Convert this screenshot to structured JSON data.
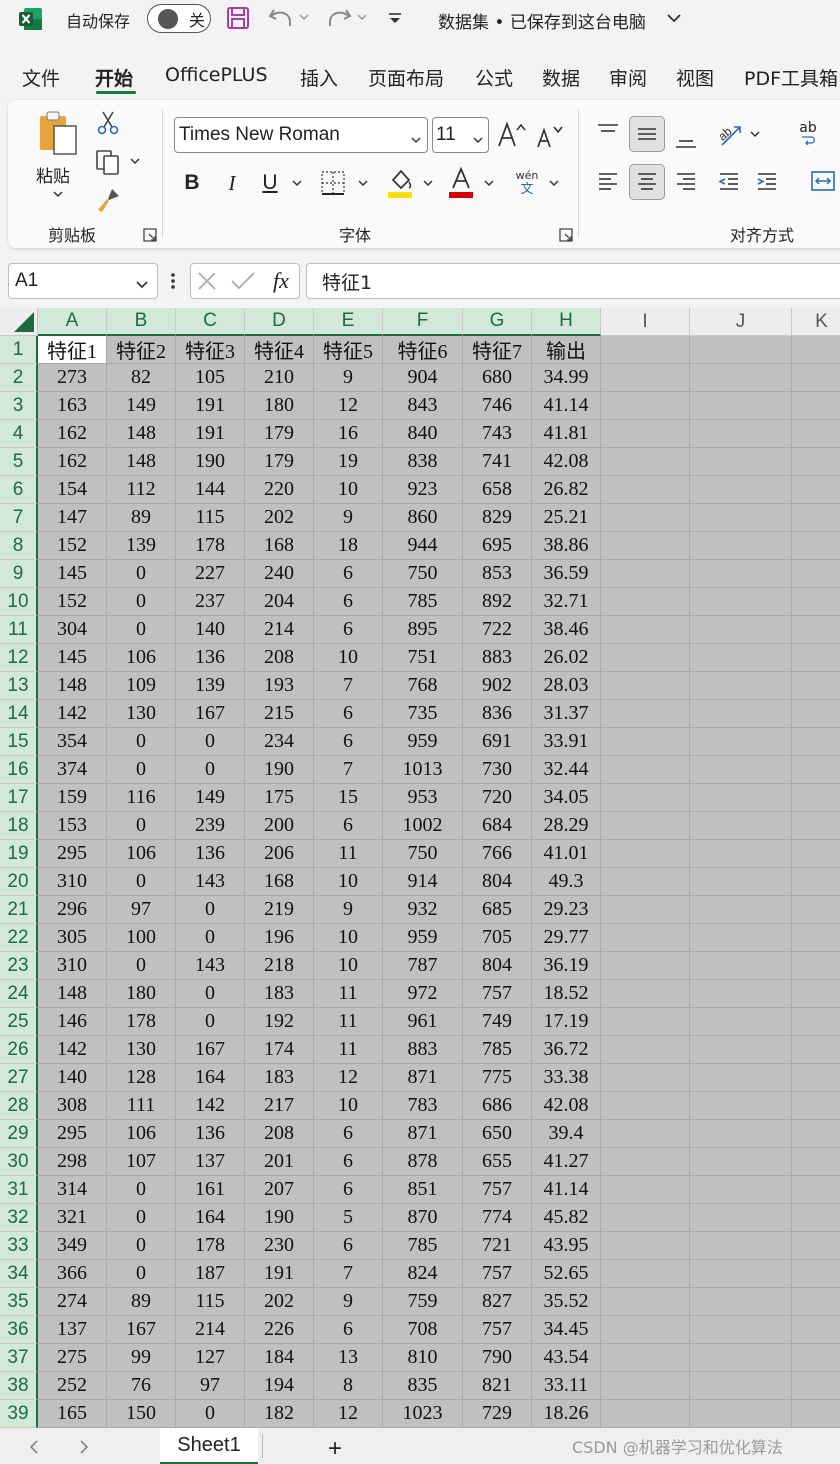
{
  "titlebar": {
    "autosave_label": "自动保存",
    "toggle_state": "关",
    "doc_title": "数据集 • 已保存到这台电脑"
  },
  "menu": {
    "tabs": [
      "文件",
      "开始",
      "OfficePLUS",
      "插入",
      "页面布局",
      "公式",
      "数据",
      "审阅",
      "视图",
      "PDF工具箱"
    ],
    "active": "开始"
  },
  "ribbon": {
    "clipboard": {
      "paste_label": "粘贴",
      "group_label": "剪贴板"
    },
    "font": {
      "font_name": "Times New Roman",
      "font_size": "11",
      "phonetic_top": "wén",
      "phonetic_bottom": "文",
      "group_label": "字体",
      "fill_color": "#ffe000",
      "font_color": "#d40000"
    },
    "alignment": {
      "group_label": "对齐方式",
      "wrap_label": "ab"
    }
  },
  "formula_bar": {
    "name_box": "A1",
    "fx": "fx",
    "content": "特征1"
  },
  "grid": {
    "columns": [
      "A",
      "B",
      "C",
      "D",
      "E",
      "F",
      "G",
      "H",
      "I",
      "J",
      "K"
    ],
    "row_numbers": [
      "1",
      "2",
      "3",
      "4",
      "5",
      "6",
      "7",
      "8",
      "9",
      "10",
      "11",
      "12",
      "13",
      "14",
      "15",
      "16",
      "17",
      "18",
      "19",
      "20",
      "21",
      "22",
      "23",
      "24",
      "25",
      "26",
      "27",
      "28",
      "29",
      "30",
      "31",
      "32",
      "33",
      "34",
      "35",
      "36",
      "37",
      "38",
      "39"
    ],
    "header": [
      "特征1",
      "特征2",
      "特征3",
      "特征4",
      "特征5",
      "特征6",
      "特征7",
      "输出"
    ],
    "rows": [
      [
        "273",
        "82",
        "105",
        "210",
        "9",
        "904",
        "680",
        "34.99"
      ],
      [
        "163",
        "149",
        "191",
        "180",
        "12",
        "843",
        "746",
        "41.14"
      ],
      [
        "162",
        "148",
        "191",
        "179",
        "16",
        "840",
        "743",
        "41.81"
      ],
      [
        "162",
        "148",
        "190",
        "179",
        "19",
        "838",
        "741",
        "42.08"
      ],
      [
        "154",
        "112",
        "144",
        "220",
        "10",
        "923",
        "658",
        "26.82"
      ],
      [
        "147",
        "89",
        "115",
        "202",
        "9",
        "860",
        "829",
        "25.21"
      ],
      [
        "152",
        "139",
        "178",
        "168",
        "18",
        "944",
        "695",
        "38.86"
      ],
      [
        "145",
        "0",
        "227",
        "240",
        "6",
        "750",
        "853",
        "36.59"
      ],
      [
        "152",
        "0",
        "237",
        "204",
        "6",
        "785",
        "892",
        "32.71"
      ],
      [
        "304",
        "0",
        "140",
        "214",
        "6",
        "895",
        "722",
        "38.46"
      ],
      [
        "145",
        "106",
        "136",
        "208",
        "10",
        "751",
        "883",
        "26.02"
      ],
      [
        "148",
        "109",
        "139",
        "193",
        "7",
        "768",
        "902",
        "28.03"
      ],
      [
        "142",
        "130",
        "167",
        "215",
        "6",
        "735",
        "836",
        "31.37"
      ],
      [
        "354",
        "0",
        "0",
        "234",
        "6",
        "959",
        "691",
        "33.91"
      ],
      [
        "374",
        "0",
        "0",
        "190",
        "7",
        "1013",
        "730",
        "32.44"
      ],
      [
        "159",
        "116",
        "149",
        "175",
        "15",
        "953",
        "720",
        "34.05"
      ],
      [
        "153",
        "0",
        "239",
        "200",
        "6",
        "1002",
        "684",
        "28.29"
      ],
      [
        "295",
        "106",
        "136",
        "206",
        "11",
        "750",
        "766",
        "41.01"
      ],
      [
        "310",
        "0",
        "143",
        "168",
        "10",
        "914",
        "804",
        "49.3"
      ],
      [
        "296",
        "97",
        "0",
        "219",
        "9",
        "932",
        "685",
        "29.23"
      ],
      [
        "305",
        "100",
        "0",
        "196",
        "10",
        "959",
        "705",
        "29.77"
      ],
      [
        "310",
        "0",
        "143",
        "218",
        "10",
        "787",
        "804",
        "36.19"
      ],
      [
        "148",
        "180",
        "0",
        "183",
        "11",
        "972",
        "757",
        "18.52"
      ],
      [
        "146",
        "178",
        "0",
        "192",
        "11",
        "961",
        "749",
        "17.19"
      ],
      [
        "142",
        "130",
        "167",
        "174",
        "11",
        "883",
        "785",
        "36.72"
      ],
      [
        "140",
        "128",
        "164",
        "183",
        "12",
        "871",
        "775",
        "33.38"
      ],
      [
        "308",
        "111",
        "142",
        "217",
        "10",
        "783",
        "686",
        "42.08"
      ],
      [
        "295",
        "106",
        "136",
        "208",
        "6",
        "871",
        "650",
        "39.4"
      ],
      [
        "298",
        "107",
        "137",
        "201",
        "6",
        "878",
        "655",
        "41.27"
      ],
      [
        "314",
        "0",
        "161",
        "207",
        "6",
        "851",
        "757",
        "41.14"
      ],
      [
        "321",
        "0",
        "164",
        "190",
        "5",
        "870",
        "774",
        "45.82"
      ],
      [
        "349",
        "0",
        "178",
        "230",
        "6",
        "785",
        "721",
        "43.95"
      ],
      [
        "366",
        "0",
        "187",
        "191",
        "7",
        "824",
        "757",
        "52.65"
      ],
      [
        "274",
        "89",
        "115",
        "202",
        "9",
        "759",
        "827",
        "35.52"
      ],
      [
        "137",
        "167",
        "214",
        "226",
        "6",
        "708",
        "757",
        "34.45"
      ],
      [
        "275",
        "99",
        "127",
        "184",
        "13",
        "810",
        "790",
        "43.54"
      ],
      [
        "252",
        "76",
        "97",
        "194",
        "8",
        "835",
        "821",
        "33.11"
      ],
      [
        "165",
        "150",
        "0",
        "182",
        "12",
        "1023",
        "729",
        "18.26"
      ]
    ]
  },
  "sheets": {
    "tabs": [
      "Sheet1"
    ],
    "add_label": "+"
  },
  "watermark": "CSDN @机器学习和优化算法",
  "colors": {
    "accent": "#1e6b3f",
    "cell_bg": "#c0c0c0",
    "selected_cell_bg": "#ffffff"
  }
}
